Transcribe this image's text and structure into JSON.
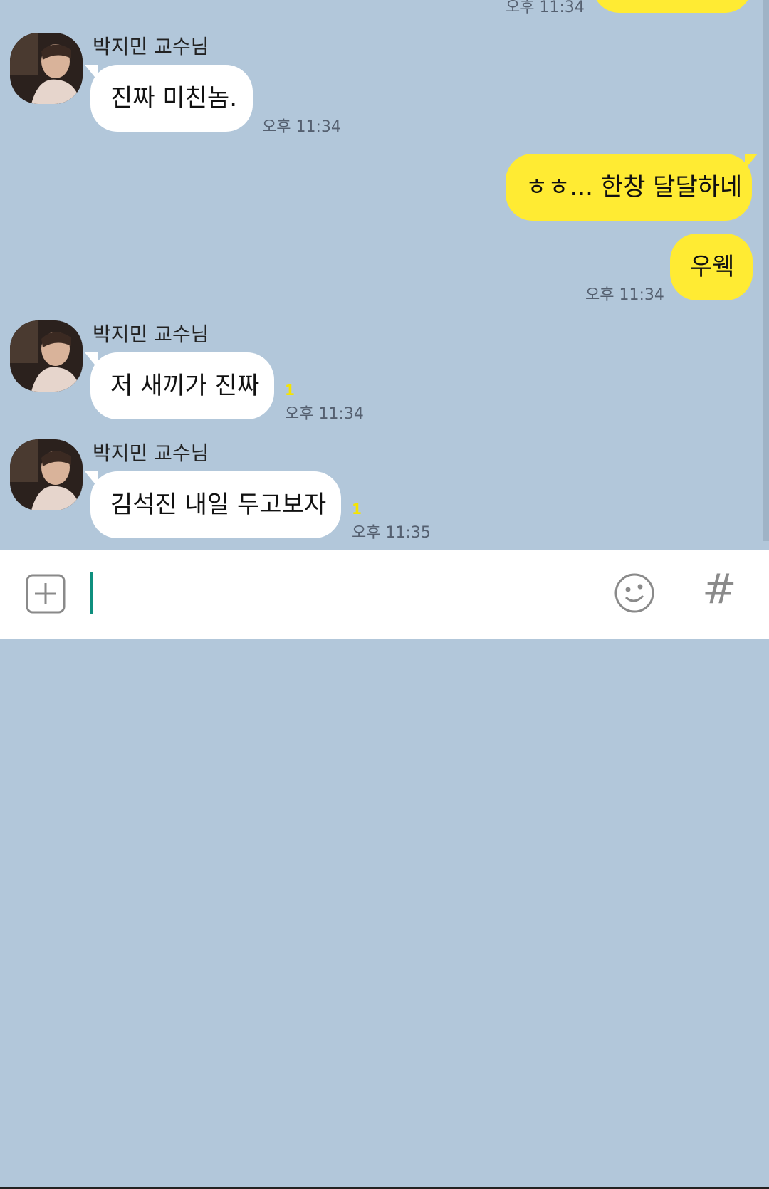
{
  "messages_top_partial": {
    "time": "오후 11:34"
  },
  "messages": [
    {
      "sender": "박지민 교수님",
      "text": "진짜 미친놈.",
      "time": "오후 11:34"
    },
    {
      "text": "ㅎㅎ... 한창 달달하네"
    },
    {
      "text": "우웩",
      "time": "오후 11:34"
    },
    {
      "sender": "박지민 교수님",
      "text": "저 새끼가 진짜",
      "unread": "1",
      "time": "오후 11:34"
    },
    {
      "sender": "박지민 교수님",
      "text": "김석진 내일 두고보자",
      "unread": "1",
      "time": "오후 11:35"
    }
  ],
  "icons": {
    "attach": "plus-square-icon",
    "emoji": "smiley-icon",
    "hash": "hash-icon"
  },
  "input": {
    "hash_glyph": "#"
  },
  "colors": {
    "chat_background": "#b2c7da",
    "my_bubble": "#ffeb33",
    "their_bubble": "#ffffff",
    "cursor": "#0e8f7e"
  }
}
